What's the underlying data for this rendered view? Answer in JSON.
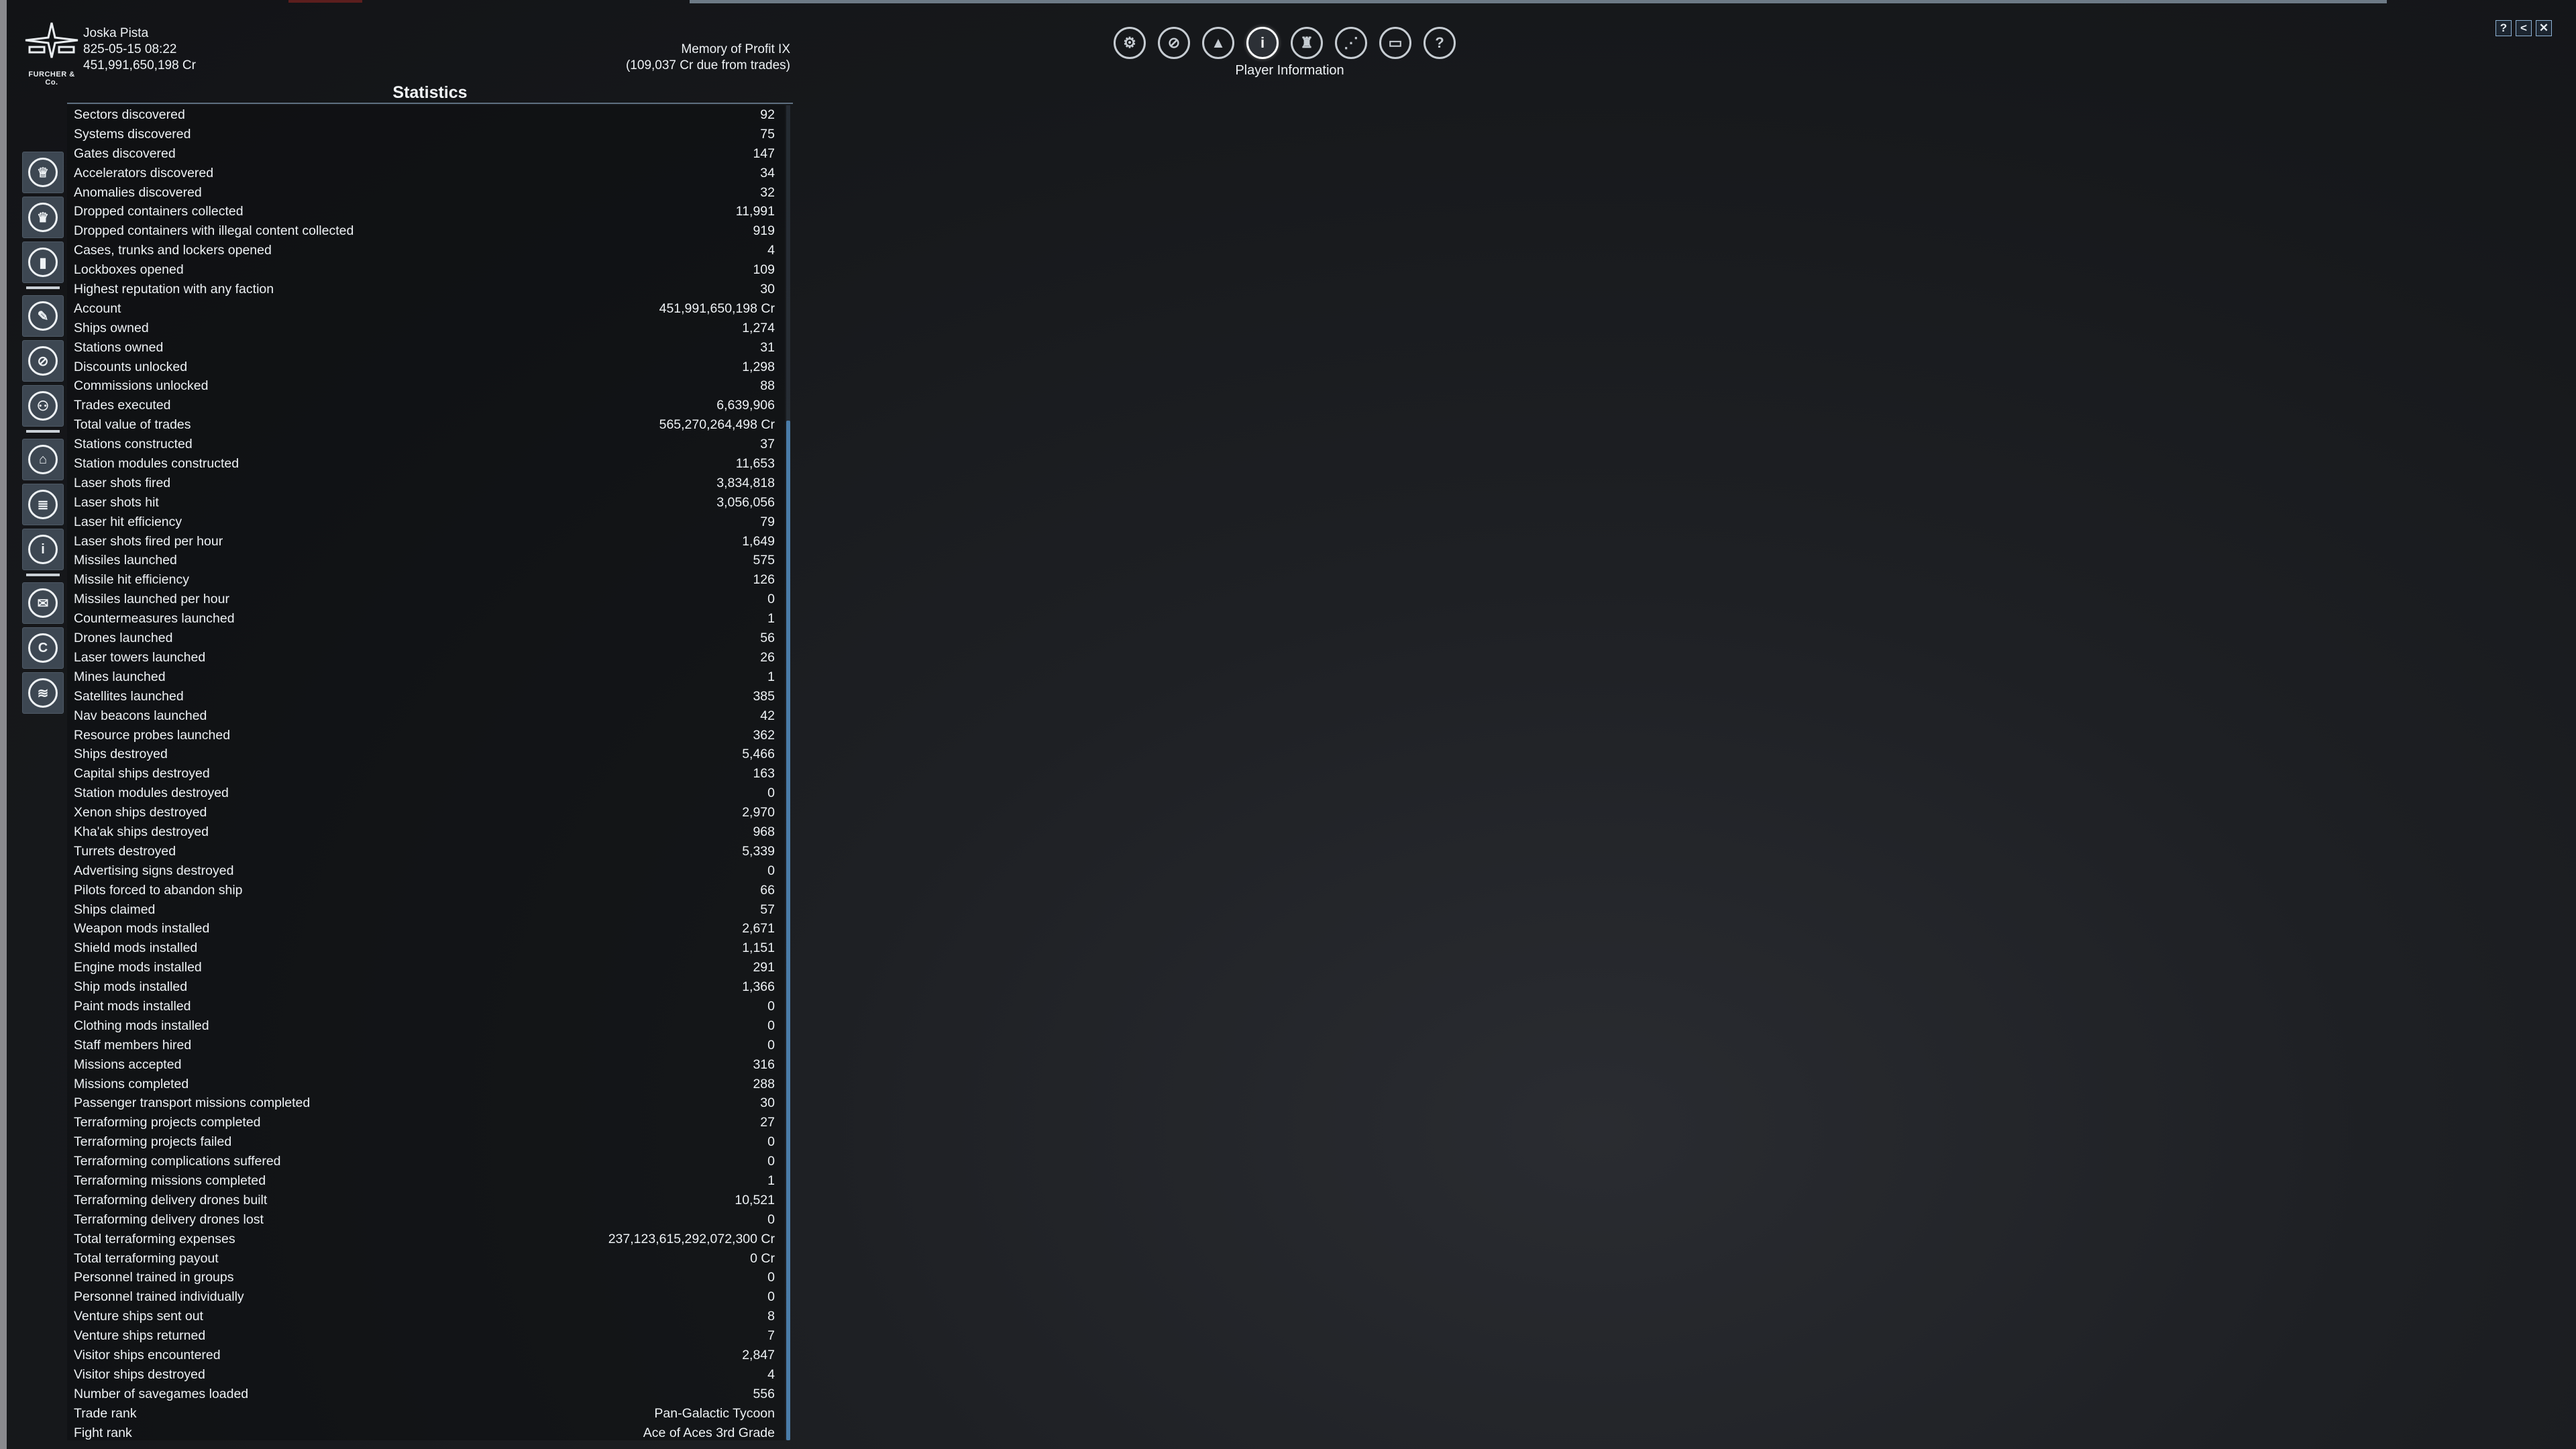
{
  "logo_text": "FURCHER & Co.",
  "header": {
    "player_name": "Joska Pista",
    "datetime": "825-05-15 08:22",
    "credits": "451,991,650,198 Cr",
    "ship_name": "Memory of Profit IX",
    "trade_note": "(109,037 Cr due from trades)"
  },
  "panel_title": "Statistics",
  "top_menu": {
    "active_label": "Player Information",
    "icons": [
      "gear-icon",
      "search-icon",
      "ship-icon",
      "player-icon",
      "crew-icon",
      "network-icon",
      "bed-icon",
      "help-icon"
    ],
    "glyphs": [
      "⚙",
      "⊘",
      "▲",
      "i",
      "♜",
      "⋰",
      "▭",
      "?"
    ]
  },
  "window_buttons": [
    "?",
    "<",
    "✕"
  ],
  "sidebar": {
    "icons": [
      "empire-icon",
      "factions-icon",
      "stats-icon",
      "logbook-icon",
      "encyclopedia-icon",
      "transactions-icon",
      "personal-icon",
      "inventory-icon",
      "account-icon",
      "diplomacy-icon",
      "research-icon",
      "terraforming-icon"
    ],
    "glyphs": [
      "♕",
      "♛",
      "▮",
      "✎",
      "⊘",
      "⚇",
      "⌂",
      "≣",
      "i",
      "✉",
      "C",
      "≋"
    ]
  },
  "statistics": [
    {
      "label": "Sectors discovered",
      "value": "92"
    },
    {
      "label": "Systems discovered",
      "value": "75"
    },
    {
      "label": "Gates discovered",
      "value": "147"
    },
    {
      "label": "Accelerators discovered",
      "value": "34"
    },
    {
      "label": "Anomalies discovered",
      "value": "32"
    },
    {
      "label": "Dropped containers collected",
      "value": "11,991"
    },
    {
      "label": "Dropped containers with illegal content collected",
      "value": "919"
    },
    {
      "label": "Cases, trunks and lockers opened",
      "value": "4"
    },
    {
      "label": "Lockboxes opened",
      "value": "109"
    },
    {
      "label": "Highest reputation with any faction",
      "value": "30"
    },
    {
      "label": "Account",
      "value": "451,991,650,198 Cr"
    },
    {
      "label": "Ships owned",
      "value": "1,274"
    },
    {
      "label": "Stations owned",
      "value": "31"
    },
    {
      "label": "Discounts unlocked",
      "value": "1,298"
    },
    {
      "label": "Commissions unlocked",
      "value": "88"
    },
    {
      "label": "Trades executed",
      "value": "6,639,906"
    },
    {
      "label": "Total value of trades",
      "value": "565,270,264,498 Cr"
    },
    {
      "label": "Stations constructed",
      "value": "37"
    },
    {
      "label": "Station modules constructed",
      "value": "11,653"
    },
    {
      "label": "Laser shots fired",
      "value": "3,834,818"
    },
    {
      "label": "Laser shots hit",
      "value": "3,056,056"
    },
    {
      "label": "Laser hit efficiency",
      "value": "79"
    },
    {
      "label": "Laser shots fired per hour",
      "value": "1,649"
    },
    {
      "label": "Missiles launched",
      "value": "575"
    },
    {
      "label": "Missile hit efficiency",
      "value": "126"
    },
    {
      "label": "Missiles launched per hour",
      "value": "0"
    },
    {
      "label": "Countermeasures launched",
      "value": "1"
    },
    {
      "label": "Drones launched",
      "value": "56"
    },
    {
      "label": "Laser towers launched",
      "value": "26"
    },
    {
      "label": "Mines launched",
      "value": "1"
    },
    {
      "label": "Satellites launched",
      "value": "385"
    },
    {
      "label": "Nav beacons launched",
      "value": "42"
    },
    {
      "label": "Resource probes launched",
      "value": "362"
    },
    {
      "label": "Ships destroyed",
      "value": "5,466"
    },
    {
      "label": "Capital ships destroyed",
      "value": "163"
    },
    {
      "label": "Station modules destroyed",
      "value": "0"
    },
    {
      "label": "Xenon ships destroyed",
      "value": "2,970"
    },
    {
      "label": "Kha'ak ships destroyed",
      "value": "968"
    },
    {
      "label": "Turrets destroyed",
      "value": "5,339"
    },
    {
      "label": "Advertising signs destroyed",
      "value": "0"
    },
    {
      "label": "Pilots forced to abandon ship",
      "value": "66"
    },
    {
      "label": "Ships claimed",
      "value": "57"
    },
    {
      "label": "Weapon mods installed",
      "value": "2,671"
    },
    {
      "label": "Shield mods installed",
      "value": "1,151"
    },
    {
      "label": "Engine mods installed",
      "value": "291"
    },
    {
      "label": "Ship mods installed",
      "value": "1,366"
    },
    {
      "label": "Paint mods installed",
      "value": "0"
    },
    {
      "label": "Clothing mods installed",
      "value": "0"
    },
    {
      "label": "Staff members hired",
      "value": "0"
    },
    {
      "label": "Missions accepted",
      "value": "316"
    },
    {
      "label": "Missions completed",
      "value": "288"
    },
    {
      "label": "Passenger transport missions completed",
      "value": "30"
    },
    {
      "label": "Terraforming projects completed",
      "value": "27"
    },
    {
      "label": "Terraforming projects failed",
      "value": "0"
    },
    {
      "label": "Terraforming complications suffered",
      "value": "0"
    },
    {
      "label": "Terraforming missions completed",
      "value": "1"
    },
    {
      "label": "Terraforming delivery drones built",
      "value": "10,521"
    },
    {
      "label": "Terraforming delivery drones lost",
      "value": "0"
    },
    {
      "label": "Total terraforming expenses",
      "value": "237,123,615,292,072,300 Cr"
    },
    {
      "label": "Total terraforming payout",
      "value": "0 Cr"
    },
    {
      "label": "Personnel trained in groups",
      "value": "0"
    },
    {
      "label": "Personnel trained individually",
      "value": "0"
    },
    {
      "label": "Venture ships sent out",
      "value": "8"
    },
    {
      "label": "Venture ships returned",
      "value": "7"
    },
    {
      "label": "Visitor ships encountered",
      "value": "2,847"
    },
    {
      "label": "Visitor ships destroyed",
      "value": "4"
    },
    {
      "label": "Number of savegames loaded",
      "value": "556"
    },
    {
      "label": "Trade rank",
      "value": "Pan-Galactic Tycoon"
    },
    {
      "label": "Fight rank",
      "value": "Ace of Aces 3rd Grade"
    }
  ]
}
